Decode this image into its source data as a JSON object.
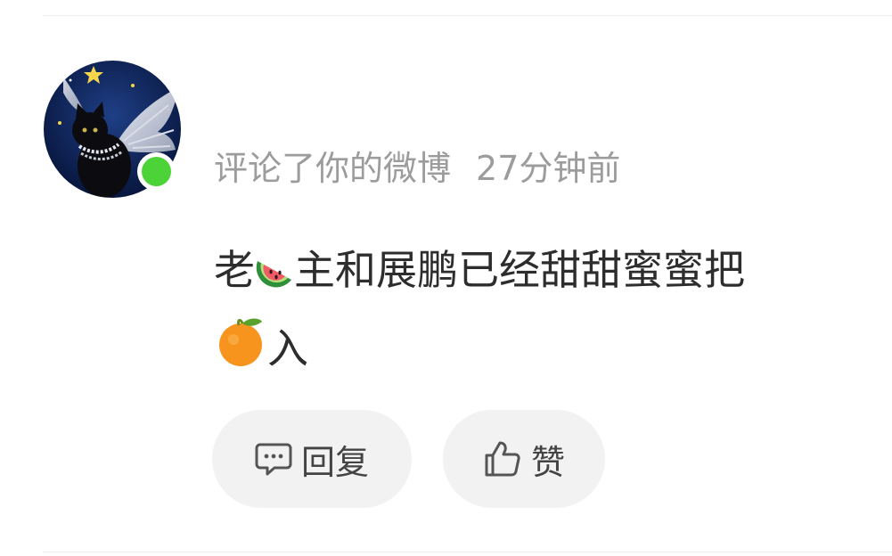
{
  "notification": {
    "action_text": "评论了你的微博",
    "time_ago": "27分钟前",
    "comment": {
      "part1": "老",
      "emoji1": "watermelon",
      "part2": "主和展鹏已经甜甜蜜蜜把",
      "emoji2": "tangerine",
      "part3": "入"
    },
    "reply_label": "回复",
    "like_label": "赞",
    "online_status_color": "#4cd337"
  }
}
